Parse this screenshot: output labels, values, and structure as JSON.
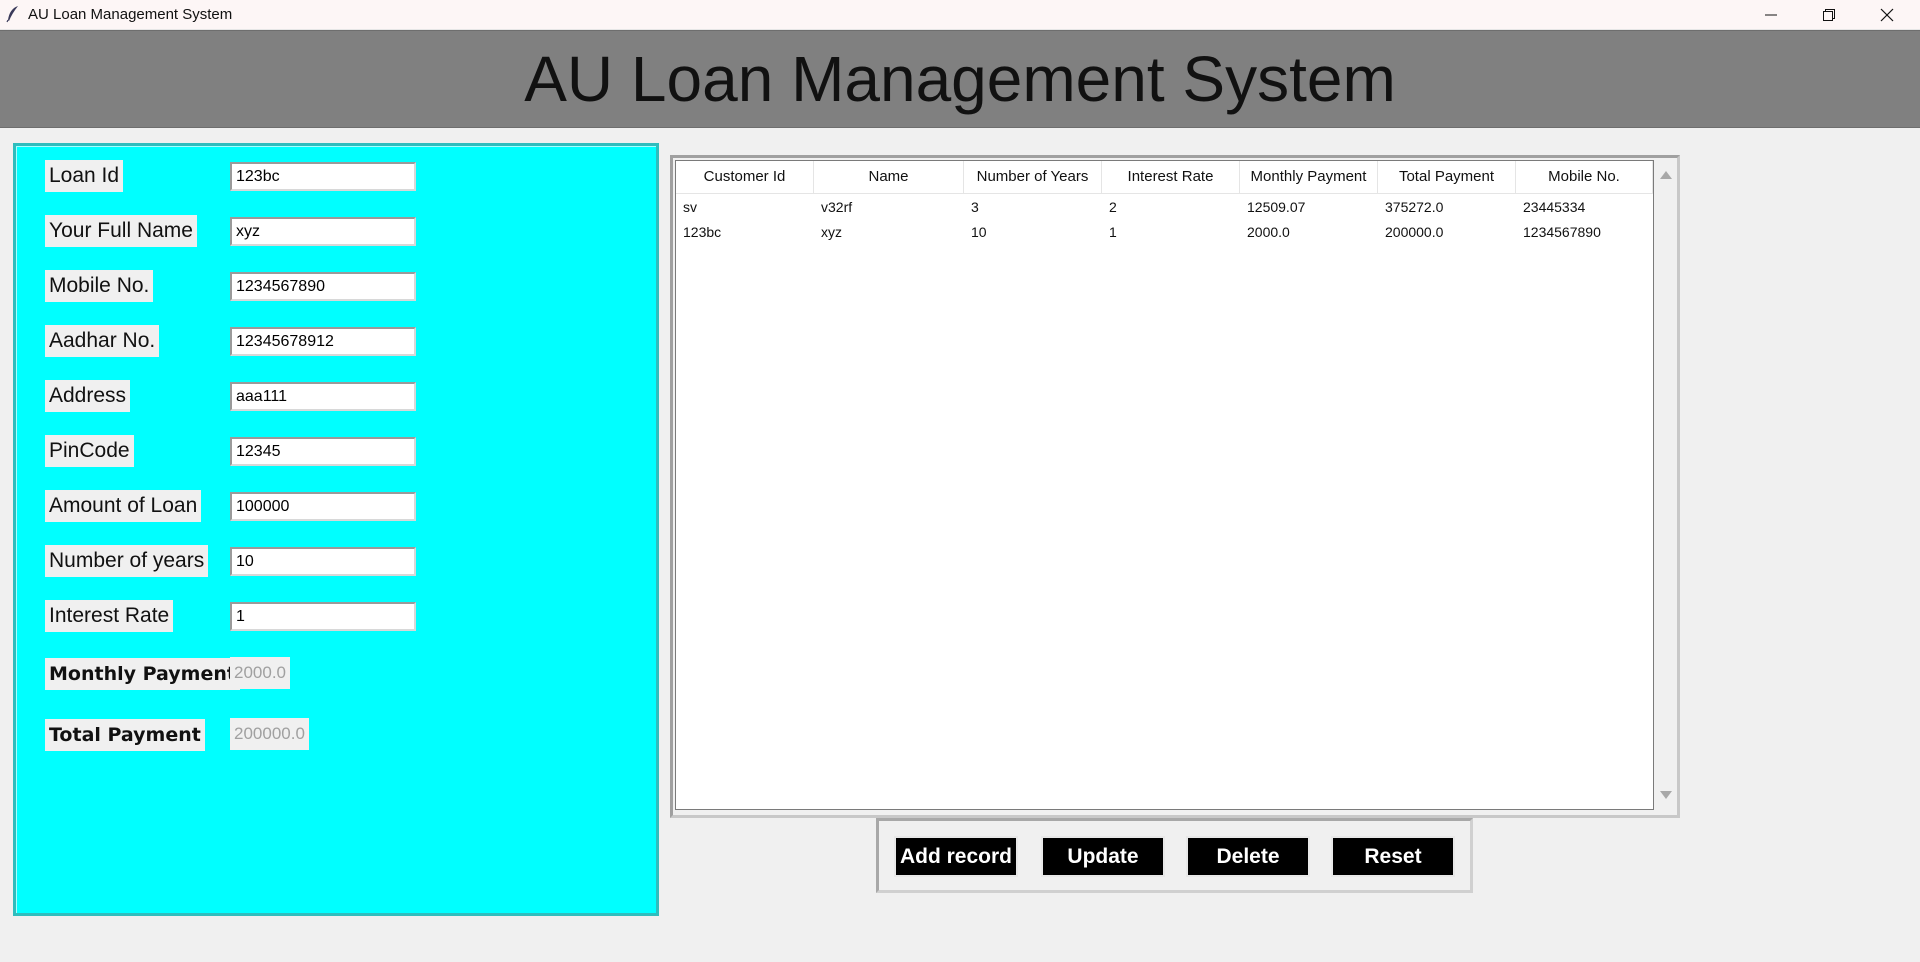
{
  "window": {
    "title": "AU Loan Management System"
  },
  "header": {
    "title": "AU Loan Management System"
  },
  "form": {
    "fields": [
      {
        "label": "Loan Id",
        "value": "123bc"
      },
      {
        "label": "Your Full Name",
        "value": "xyz"
      },
      {
        "label": "Mobile No.",
        "value": "1234567890"
      },
      {
        "label": "Aadhar No.",
        "value": "12345678912"
      },
      {
        "label": "Address",
        "value": "aaa111"
      },
      {
        "label": "PinCode",
        "value": "12345"
      },
      {
        "label": "Amount of Loan",
        "value": "100000"
      },
      {
        "label": "Number of years",
        "value": "10"
      },
      {
        "label": "Interest Rate",
        "value": "1"
      }
    ],
    "monthly_payment": {
      "label": "Monthly Payment",
      "value": "2000.0"
    },
    "total_payment": {
      "label": "Total Payment",
      "value": "200000.0"
    }
  },
  "table": {
    "columns": [
      "Customer Id",
      "Name",
      "Number of Years",
      "Interest Rate",
      "Monthly Payment",
      "Total Payment",
      "Mobile No."
    ],
    "rows": [
      [
        "sv",
        "v32rf",
        "3",
        "2",
        "12509.07",
        "375272.0",
        "23445334"
      ],
      [
        "123bc",
        "xyz",
        "10",
        "1",
        "2000.0",
        "200000.0",
        "1234567890"
      ]
    ]
  },
  "buttons": {
    "add": "Add record",
    "update": "Update",
    "delete": "Delete",
    "reset": "Reset"
  },
  "colors": {
    "form_bg": "#00ffff",
    "header_bg": "#808080",
    "button_bg": "#000000"
  }
}
